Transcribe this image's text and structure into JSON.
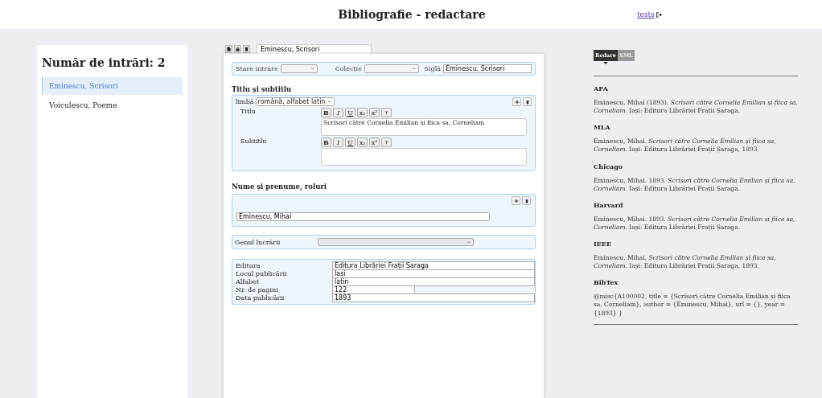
{
  "header": {
    "title": "Bibliografie - redactare",
    "user_link": "tests"
  },
  "sidebar": {
    "heading": "Număr de intrări: 2",
    "items": [
      {
        "label": "Eminescu, Scrisori",
        "selected": true
      },
      {
        "label": "Voiculescu, Poeme",
        "selected": false
      }
    ]
  },
  "editor": {
    "tab_field": "Eminescu, Scrisori",
    "meta": {
      "status_label": "Stare intrare",
      "collection_label": "Colecție",
      "siglum_label": "Siglă",
      "siglum_value": "Eminescu, Scrisori"
    },
    "title_section": {
      "heading": "Titlu și subtitlu",
      "language_label": "limbă",
      "language_value": "română, alfabet latin",
      "fields": [
        {
          "label": "Titlu",
          "value": "Scrisori către Cornelia Emilian și fiica sa, Corneliam",
          "format_buttons": [
            {
              "label": "B",
              "kind": "bold"
            },
            {
              "label": "I",
              "kind": "italic"
            },
            {
              "label": "U",
              "kind": "underline"
            },
            {
              "label": "x₂",
              "kind": "subscript"
            },
            {
              "label": "x²",
              "kind": "superscript"
            }
          ]
        },
        {
          "label": "Subtitlu",
          "format_buttons": [
            {
              "label": "B",
              "kind": "bold"
            },
            {
              "label": "I",
              "kind": "italic"
            },
            {
              "label": "U",
              "kind": "underline"
            },
            {
              "label": "x₂",
              "kind": "subscript"
            },
            {
              "label": "x²",
              "kind": "superscript"
            }
          ]
        }
      ]
    },
    "authors": {
      "heading": "Nume și prenume, roluri",
      "values": [
        "Eminescu, Mihai"
      ]
    },
    "genre_label": "Genul lucrării",
    "details": [
      {
        "label": "Editura",
        "value": "Editura Librăriei Frații Șaraga",
        "kind": "wide"
      },
      {
        "label": "Locul publicării",
        "value": "Iași",
        "kind": "wide"
      },
      {
        "label": "Alfabet",
        "value": "latin",
        "kind": "wide"
      },
      {
        "label": "Nr. de pagini",
        "value": "122",
        "kind": "short"
      },
      {
        "label": "Data publicării",
        "value": "1893",
        "kind": "wide"
      }
    ]
  },
  "citations": {
    "tabs": [
      {
        "label": "Redare",
        "selected": true
      },
      {
        "label": "XML",
        "selected": false
      }
    ],
    "styles": [
      {
        "name": "APA",
        "text": "Eminescu, Mihai (1893). *Scrisori către Cornelia Emilian și fiica sa, Corneliam.* Iași: Editura Librăriei Frații Șaraga."
      },
      {
        "name": "MLA",
        "text": "Eminescu, Mihai. *Scrisori către Cornelia Emilian și fiica sa, Corneliam.* Iași: Editura Librăriei Frații Șaraga, 1893."
      },
      {
        "name": "Chicago",
        "text": "Eminescu, Mihai. 1893. *Scrisori către Cornelia Emilian și fiica sa, Corneliam.* Iași: Editura Librăriei Frații Șaraga."
      },
      {
        "name": "Harvard",
        "text": "Eminescu, Mihai. 1893. *Scrisori către Cornelia Emilian și fiica sa, Corneliam.* Iași: Editura Librăriei Frații Șaraga."
      },
      {
        "name": "IEEE",
        "text": "Eminescu, Mihai, *Scrisori către Cornelia Emilian și fiica sa, Corneliam.* Iași: Editura Librăriei Frații Șaraga, 1893."
      },
      {
        "name": "BibTex",
        "text": "@misc{A100002, title = {Scrisori către Cornelia Emilian și fiica sa, Corneliam}, author = {Eminescu, Mihai}, url = {}, year = {1893} }"
      }
    ]
  }
}
